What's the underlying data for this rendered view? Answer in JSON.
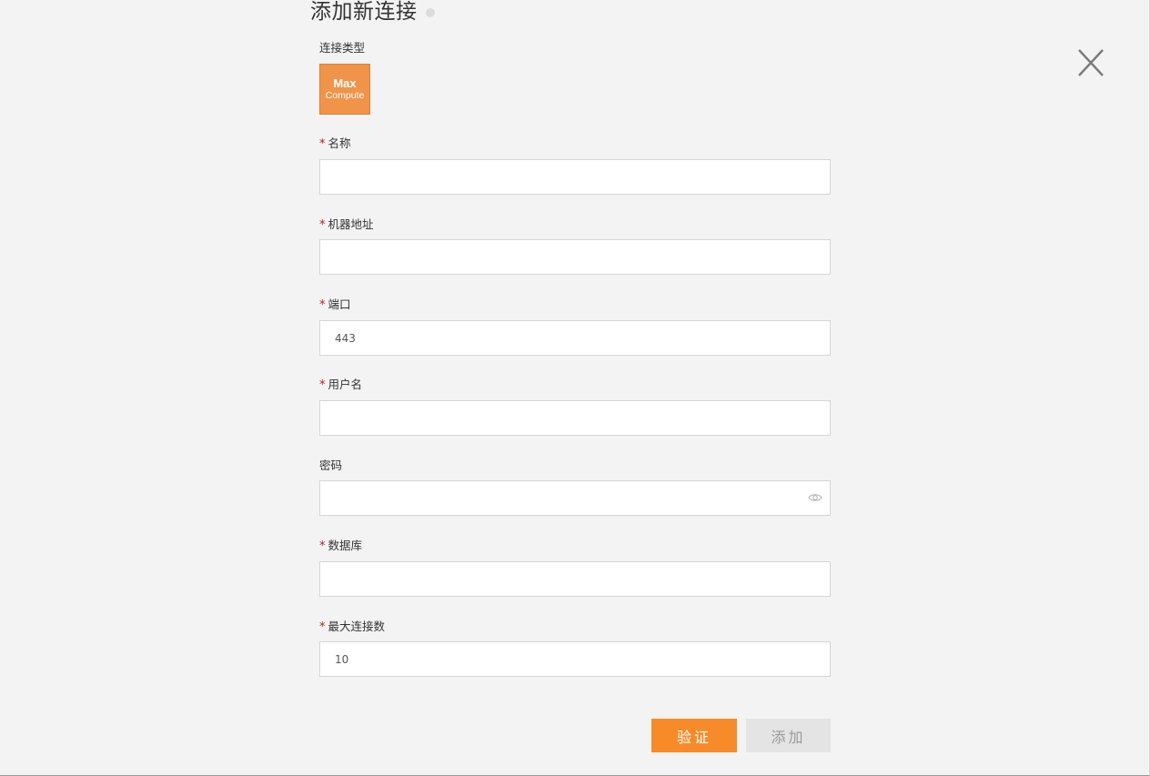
{
  "dialog": {
    "title": "添加新连接"
  },
  "connection_type": {
    "label": "连接类型",
    "tile_line1": "Max",
    "tile_line2": "Compute",
    "tile_color": "#f09449"
  },
  "fields": {
    "name": {
      "label": "名称",
      "required": true,
      "value": ""
    },
    "host": {
      "label": "机器地址",
      "required": true,
      "value": ""
    },
    "port": {
      "label": "端口",
      "required": true,
      "value": "443"
    },
    "username": {
      "label": "用户名",
      "required": true,
      "value": ""
    },
    "password": {
      "label": "密码",
      "required": false,
      "value": ""
    },
    "database": {
      "label": "数据库",
      "required": true,
      "value": ""
    },
    "max_connections": {
      "label": "最大连接数",
      "required": true,
      "value": "10"
    }
  },
  "required_mark": "*",
  "buttons": {
    "verify": "验证",
    "add": "添加"
  },
  "colors": {
    "accent": "#f78b2a",
    "required": "#c0131f",
    "disabled_button": "#e4e4e4"
  },
  "icons": {
    "close": "close-icon",
    "password_toggle": "eye-icon"
  }
}
